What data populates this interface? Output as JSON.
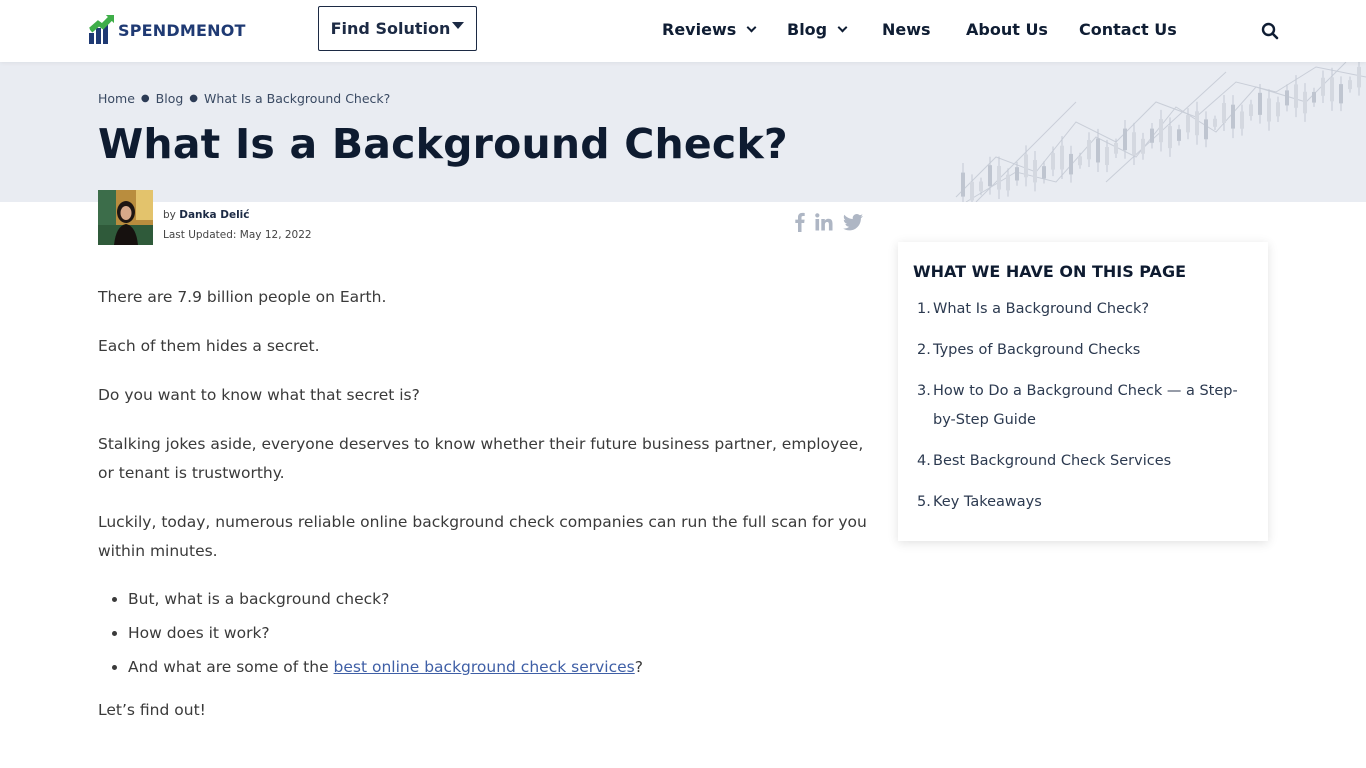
{
  "header": {
    "logo_text": "SPENDMENOT",
    "find_solution_label": "Find Solution",
    "nav": {
      "reviews": "Reviews",
      "blog": "Blog",
      "news": "News",
      "about": "About Us",
      "contact": "Contact Us"
    }
  },
  "breadcrumb": [
    "Home",
    "Blog",
    "What Is a Background Check?"
  ],
  "page_title": "What Is a Background Check?",
  "author": {
    "by_prefix": "by",
    "name": "Danka Delić",
    "updated_label": "Last Updated:",
    "updated_date": "May 12, 2022"
  },
  "share_icons": [
    "facebook-icon",
    "linkedin-icon",
    "twitter-icon"
  ],
  "article": {
    "p1": "There are 7.9 billion people on Earth.",
    "p2": "Each of them hides a secret.",
    "p3": "Do you want to know what that secret is?",
    "p4": "Stalking jokes aside, everyone deserves to know whether their future business partner, employee, or tenant is trustworthy.",
    "p5": "Luckily, today, numerous reliable online background check companies can run the full scan for you within minutes.",
    "bullet1": "But, what is a background check?",
    "bullet2": "How does it work?",
    "bullet3_prefix": "And what are some of the ",
    "bullet3_link": "best online background check services",
    "bullet3_suffix": "?",
    "p6": "Let’s find out!"
  },
  "toc": {
    "title": "WHAT WE HAVE ON THIS PAGE",
    "items": [
      {
        "num": "1.",
        "label": "What Is a Background Check?"
      },
      {
        "num": "2.",
        "label": "Types of Background Checks"
      },
      {
        "num": "3.",
        "label": "How to Do a Background Check — a Step-by-Step Guide"
      },
      {
        "num": "4.",
        "label": "Best Background Check Services"
      },
      {
        "num": "5.",
        "label": "Key Takeaways"
      }
    ]
  },
  "colors": {
    "navy": "#0e1b30",
    "hero_bg": "#e9ecf2",
    "link": "#3f5fa6",
    "logo_green": "#3fae49",
    "logo_blue": "#1f3a73"
  }
}
